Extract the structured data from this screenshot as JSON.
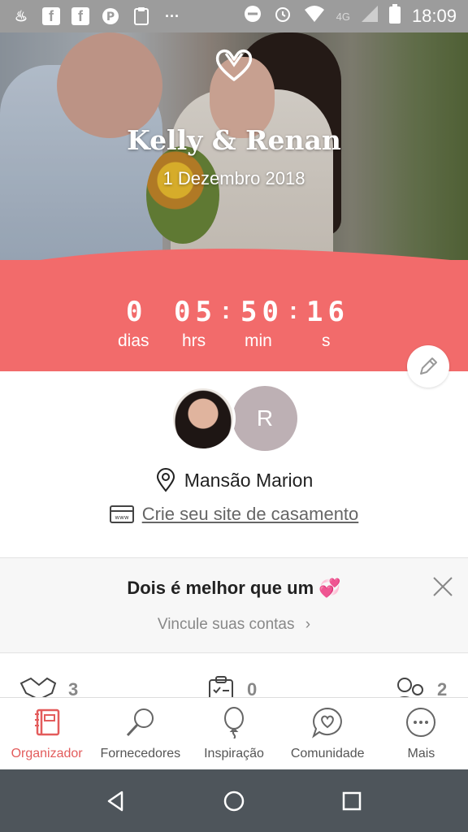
{
  "status_bar": {
    "network": "4G",
    "time": "18:09",
    "dots": "···"
  },
  "hero": {
    "couple_name": "Kelly & Renan",
    "date": "1 Dezembro 2018"
  },
  "countdown": {
    "days": "0",
    "hours": "05",
    "minutes": "50",
    "seconds": "16",
    "days_label": "dias",
    "hours_label": "hrs",
    "minutes_label": "min",
    "seconds_label": "s"
  },
  "profile": {
    "partner_initial": "R",
    "venue": "Mansão Marion",
    "site_link": "Crie seu site de casamento"
  },
  "promo": {
    "title": "Dois é melhor que um 💞",
    "subtitle": "Vincule suas contas"
  },
  "stats": [
    {
      "value": "3"
    },
    {
      "value": "0"
    },
    {
      "value": "2"
    }
  ],
  "bottom_nav": [
    {
      "label": "Organizador",
      "icon": "organizer-icon",
      "active": true
    },
    {
      "label": "Fornecedores",
      "icon": "search-icon",
      "active": false
    },
    {
      "label": "Inspiração",
      "icon": "balloon-icon",
      "active": false
    },
    {
      "label": "Comunidade",
      "icon": "chat-heart-icon",
      "active": false
    },
    {
      "label": "Mais",
      "icon": "more-icon",
      "active": false
    }
  ],
  "colors": {
    "accent": "#f26b6b",
    "active_nav": "#e35c5c",
    "status_bar": "#9c9c9c",
    "system_nav": "#4e555b"
  }
}
